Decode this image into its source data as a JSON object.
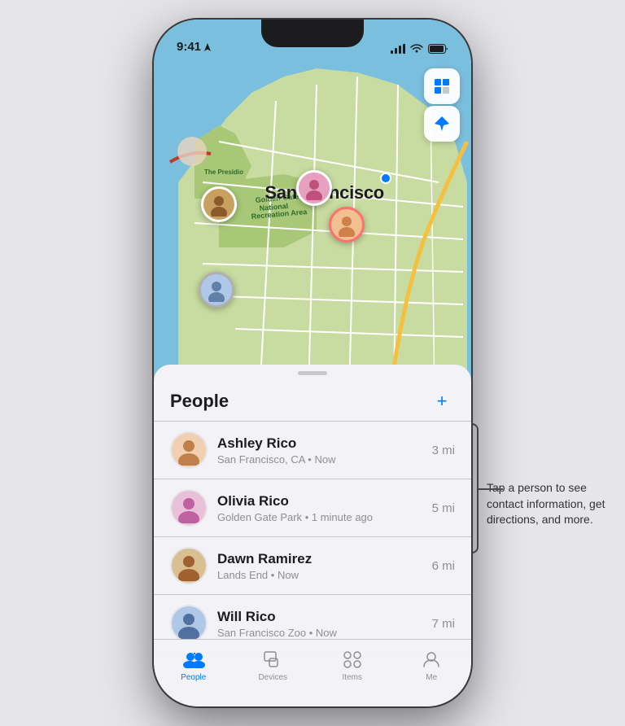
{
  "statusBar": {
    "time": "9:41",
    "locationArrow": "▶"
  },
  "mapButtons": {
    "mapIcon": "🗺",
    "locationIcon": "➤"
  },
  "mapLabel": "San Francisco",
  "people": {
    "title": "People",
    "addLabel": "+",
    "items": [
      {
        "name": "Ashley Rico",
        "location": "San Francisco, CA",
        "time": "Now",
        "distance": "3 mi",
        "emoji": "🧑"
      },
      {
        "name": "Olivia Rico",
        "location": "Golden Gate Park",
        "time": "1 minute ago",
        "distance": "5 mi",
        "emoji": "👩"
      },
      {
        "name": "Dawn Ramirez",
        "location": "Lands End",
        "time": "Now",
        "distance": "6 mi",
        "emoji": "🧔"
      },
      {
        "name": "Will Rico",
        "location": "San Francisco Zoo",
        "time": "Now",
        "distance": "7 mi",
        "emoji": "🧑‍🦱"
      }
    ]
  },
  "tabs": [
    {
      "label": "People",
      "active": true
    },
    {
      "label": "Devices",
      "active": false
    },
    {
      "label": "Items",
      "active": false
    },
    {
      "label": "Me",
      "active": false
    }
  ],
  "annotation": {
    "text": "Tap a person to see contact information, get directions, and more."
  },
  "avatarColors": {
    "ashley": "#e8a87c",
    "olivia": "#c878a0",
    "dawn": "#c8a060",
    "will": "#7090c8"
  }
}
